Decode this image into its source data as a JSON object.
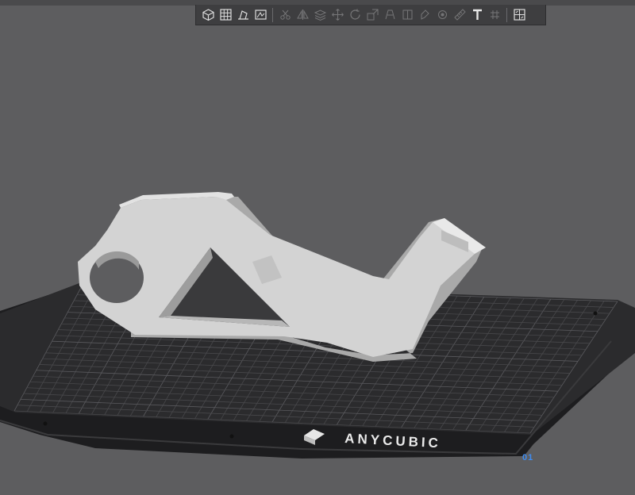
{
  "toolbar": {
    "tools": [
      {
        "icon": "cube-view-icon",
        "enabled": true
      },
      {
        "icon": "grid-arrange-icon",
        "enabled": true
      },
      {
        "icon": "lay-on-face-icon",
        "enabled": true
      },
      {
        "icon": "split-view-icon",
        "enabled": true
      },
      {
        "icon": "cut-icon",
        "enabled": false
      },
      {
        "icon": "mirror-icon",
        "enabled": false
      },
      {
        "icon": "layers-icon",
        "enabled": false
      },
      {
        "icon": "move-icon",
        "enabled": false
      },
      {
        "icon": "rotate-icon",
        "enabled": false
      },
      {
        "icon": "scale-icon",
        "enabled": false
      },
      {
        "icon": "support-paint-icon",
        "enabled": false
      },
      {
        "icon": "seam-paint-icon",
        "enabled": false
      },
      {
        "icon": "color-paint-icon",
        "enabled": false
      },
      {
        "icon": "brim-ears-icon",
        "enabled": false
      },
      {
        "icon": "measure-icon",
        "enabled": false
      },
      {
        "icon": "text-tool-icon",
        "enabled": true
      },
      {
        "icon": "assembly-icon",
        "enabled": false
      },
      {
        "icon": "view-toggle-icon",
        "enabled": true
      }
    ],
    "separator_after": [
      3,
      16
    ]
  },
  "plate": {
    "brand": "ANYCUBIC",
    "plate_number": "01"
  },
  "colors": {
    "background": "#5d5d5f",
    "plate_surface": "#2b2b2d",
    "plate_grid": "#48484b",
    "plate_base": "#1d1d1f",
    "model": "#d3d3d3",
    "model_shadow": "#a9a9a9",
    "accent": "#3f8cf0"
  }
}
